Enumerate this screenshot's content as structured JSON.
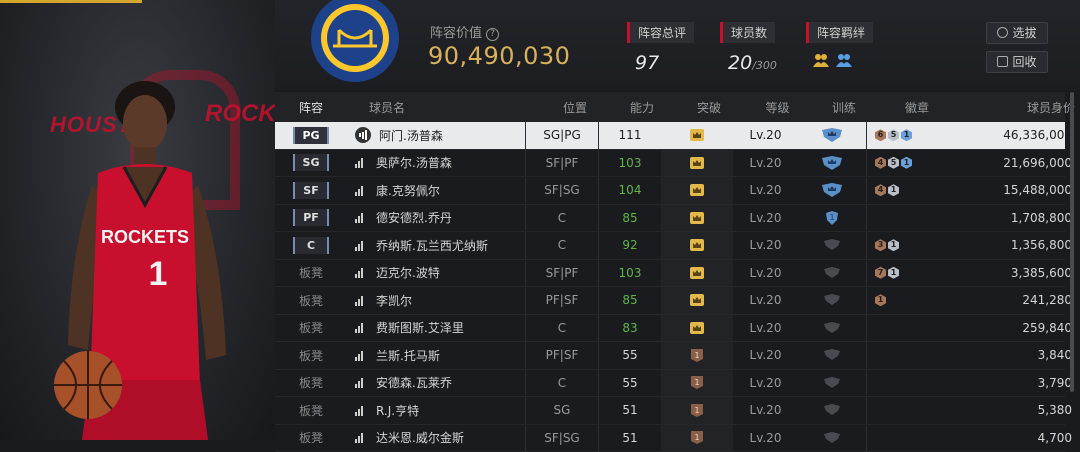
{
  "header": {
    "value_label": "阵容价值",
    "value": "90,490,030",
    "stats": [
      {
        "label": "阵容总评",
        "value": "97"
      },
      {
        "label": "球员数",
        "value": "20",
        "sub": "/300"
      },
      {
        "label": "阵容羁绊"
      }
    ],
    "buttons": {
      "select": "选拔",
      "recycle": "回收"
    }
  },
  "left_panel": {
    "text_left": "HOUST",
    "text_right": "ROCK"
  },
  "columns": [
    "阵容",
    "球员名",
    "位置",
    "能力",
    "突破",
    "等级",
    "训练",
    "徽章",
    "球员身价"
  ],
  "rows": [
    {
      "slot": "PG",
      "name": "阿门.汤普森",
      "pos": "SG|PG",
      "ability": "111",
      "ability_green": false,
      "breakthrough": "gold",
      "level": "Lv.20",
      "training": "blue",
      "badges": [
        {
          "n": "6",
          "c": "bronze"
        },
        {
          "n": "5",
          "c": "silver"
        },
        {
          "n": "1",
          "c": "blue"
        }
      ],
      "price": "46,336,000",
      "selected": true
    },
    {
      "slot": "SG",
      "name": "奥萨尔.汤普森",
      "pos": "SF|PF",
      "ability": "103",
      "ability_green": true,
      "breakthrough": "gold",
      "level": "Lv.20",
      "training": "blue",
      "badges": [
        {
          "n": "4",
          "c": "bronze"
        },
        {
          "n": "5",
          "c": "silver"
        },
        {
          "n": "1",
          "c": "blue"
        }
      ],
      "price": "21,696,000",
      "selected": false
    },
    {
      "slot": "SF",
      "name": "康.克努佩尔",
      "pos": "SF|SG",
      "ability": "104",
      "ability_green": true,
      "breakthrough": "gold",
      "level": "Lv.20",
      "training": "blue",
      "badges": [
        {
          "n": "4",
          "c": "bronze"
        },
        {
          "n": "1",
          "c": "silver"
        }
      ],
      "price": "15,488,000",
      "selected": false
    },
    {
      "slot": "PF",
      "name": "德安德烈.乔丹",
      "pos": "C",
      "ability": "85",
      "ability_green": true,
      "breakthrough": "gold",
      "level": "Lv.20",
      "training": "blue1",
      "badges": [],
      "price": "1,708,800",
      "selected": false
    },
    {
      "slot": "C",
      "name": "乔纳斯.瓦兰西尤纳斯",
      "pos": "C",
      "ability": "92",
      "ability_green": true,
      "breakthrough": "gold",
      "level": "Lv.20",
      "training": "gray",
      "badges": [
        {
          "n": "3",
          "c": "bronze"
        },
        {
          "n": "1",
          "c": "silver"
        }
      ],
      "price": "1,356,800",
      "selected": false
    },
    {
      "slot": "板凳",
      "name": "迈克尔.波特",
      "pos": "SF|PF",
      "ability": "103",
      "ability_green": true,
      "breakthrough": "gold",
      "level": "Lv.20",
      "training": "gray",
      "badges": [
        {
          "n": "7",
          "c": "bronze"
        },
        {
          "n": "1",
          "c": "silver"
        }
      ],
      "price": "3,385,600",
      "selected": false
    },
    {
      "slot": "板凳",
      "name": "李凯尔",
      "pos": "PF|SF",
      "ability": "85",
      "ability_green": true,
      "breakthrough": "gold",
      "level": "Lv.20",
      "training": "gray",
      "badges": [
        {
          "n": "1",
          "c": "bronze"
        }
      ],
      "price": "241,280",
      "selected": false
    },
    {
      "slot": "板凳",
      "name": "费斯图斯.艾泽里",
      "pos": "C",
      "ability": "83",
      "ability_green": true,
      "breakthrough": "gold",
      "level": "Lv.20",
      "training": "gray",
      "badges": [],
      "price": "259,840",
      "selected": false
    },
    {
      "slot": "板凳",
      "name": "兰斯.托马斯",
      "pos": "PF|SF",
      "ability": "55",
      "ability_green": false,
      "breakthrough": "bronze",
      "level": "Lv.20",
      "training": "gray",
      "badges": [],
      "price": "3,840",
      "selected": false
    },
    {
      "slot": "板凳",
      "name": "安德森.瓦莱乔",
      "pos": "C",
      "ability": "55",
      "ability_green": false,
      "breakthrough": "bronze",
      "level": "Lv.20",
      "training": "gray",
      "badges": [],
      "price": "3,790",
      "selected": false
    },
    {
      "slot": "板凳",
      "name": "R.J.亨特",
      "pos": "SG",
      "ability": "51",
      "ability_green": false,
      "breakthrough": "bronze",
      "level": "Lv.20",
      "training": "gray",
      "badges": [],
      "price": "5,380",
      "selected": false
    },
    {
      "slot": "板凳",
      "name": "达米恩.威尔金斯",
      "pos": "SF|SG",
      "ability": "51",
      "ability_green": false,
      "breakthrough": "bronze",
      "level": "Lv.20",
      "training": "gray",
      "badges": [],
      "price": "4,700",
      "selected": false
    }
  ],
  "colors": {
    "gold": "#d9b15a",
    "accent_red": "#c8102e",
    "green": "#5fb54a",
    "training_blue": "#5a8fc8"
  }
}
